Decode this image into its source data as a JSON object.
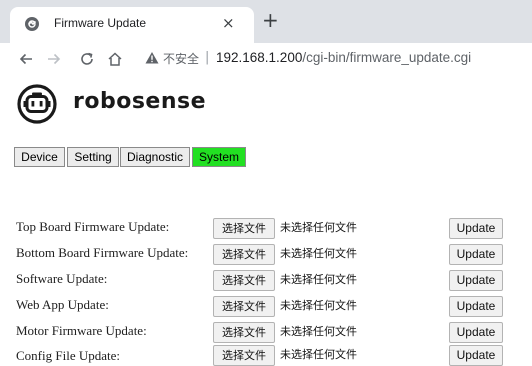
{
  "browser": {
    "tab_title": "Firmware Update",
    "tab_close": "×",
    "new_tab": "+",
    "insecure_label": "不安全",
    "separator": "|",
    "url_host": "192.168.1.200",
    "url_path": "/cgi-bin/firmware_update.cgi"
  },
  "logo": {
    "text": "robosense"
  },
  "nav": {
    "tabs": [
      "Device",
      "Setting",
      "Diagnostic",
      "System"
    ],
    "active": "System",
    "active_color": "#22e022"
  },
  "update_rows": [
    {
      "label": "Top Board Firmware Update:",
      "choose_label": "选择文件",
      "status": "未选择任何文件",
      "update_label": "Update"
    },
    {
      "label": "Bottom Board Firmware Update:",
      "choose_label": "选择文件",
      "status": "未选择任何文件",
      "update_label": "Update"
    },
    {
      "label": "Software Update:",
      "choose_label": "选择文件",
      "status": "未选择任何文件",
      "update_label": "Update"
    },
    {
      "label": "Web App Update:",
      "choose_label": "选择文件",
      "status": "未选择任何文件",
      "update_label": "Update"
    },
    {
      "label": "Motor Firmware Update:",
      "choose_label": "选择文件",
      "status": "未选择任何文件",
      "update_label": "Update"
    },
    {
      "label": "Config File Update:",
      "choose_label": "选择文件",
      "status": "未选择任何文件",
      "update_label": "Update"
    }
  ]
}
